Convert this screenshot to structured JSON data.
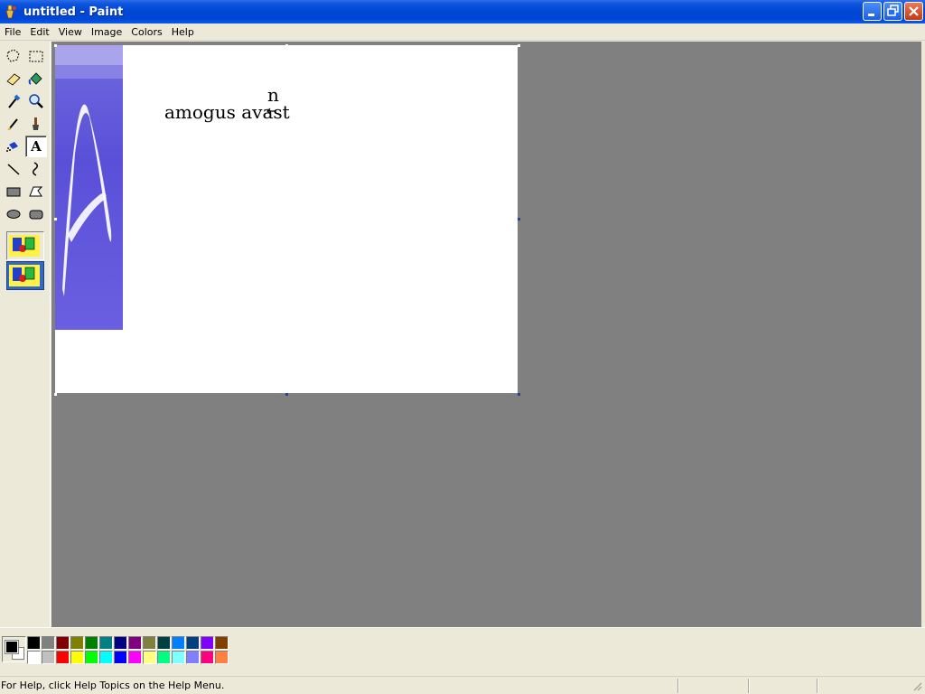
{
  "window": {
    "title": "untitled - Paint",
    "buttons": [
      "minimize",
      "restore",
      "close"
    ]
  },
  "menu": {
    "items": [
      "File",
      "Edit",
      "View",
      "Image",
      "Colors",
      "Help"
    ]
  },
  "tools": [
    {
      "name": "free-form-select-icon",
      "active": false
    },
    {
      "name": "select-icon",
      "active": false
    },
    {
      "name": "eraser-icon",
      "active": false
    },
    {
      "name": "fill-with-color-icon",
      "active": false
    },
    {
      "name": "pick-color-icon",
      "active": false
    },
    {
      "name": "magnifier-icon",
      "active": false
    },
    {
      "name": "pencil-icon",
      "active": false
    },
    {
      "name": "brush-icon",
      "active": false
    },
    {
      "name": "airbrush-icon",
      "active": false
    },
    {
      "name": "text-icon",
      "active": true,
      "glyph": "A"
    },
    {
      "name": "line-icon",
      "active": false
    },
    {
      "name": "curve-icon",
      "active": false
    },
    {
      "name": "rectangle-icon",
      "active": false
    },
    {
      "name": "polygon-icon",
      "active": false
    },
    {
      "name": "ellipse-icon",
      "active": false
    },
    {
      "name": "rounded-rectangle-icon",
      "active": false
    }
  ],
  "canvas": {
    "text_line": "amogus avast",
    "text_fragment": "n"
  },
  "colors": {
    "foreground": "#000000",
    "background": "#ffffff",
    "palette": [
      "#000000",
      "#808080",
      "#800000",
      "#808000",
      "#008000",
      "#008080",
      "#000080",
      "#800080",
      "#808040",
      "#004040",
      "#0080ff",
      "#004080",
      "#8000ff",
      "#804000",
      "#ffffff",
      "#c0c0c0",
      "#ff0000",
      "#ffff00",
      "#00ff00",
      "#00ffff",
      "#0000ff",
      "#ff00ff",
      "#ffff80",
      "#00ff80",
      "#80ffff",
      "#8080ff",
      "#ff0080",
      "#ff8040"
    ]
  },
  "status": {
    "help_text": "For Help, click Help Topics on the Help Menu."
  }
}
